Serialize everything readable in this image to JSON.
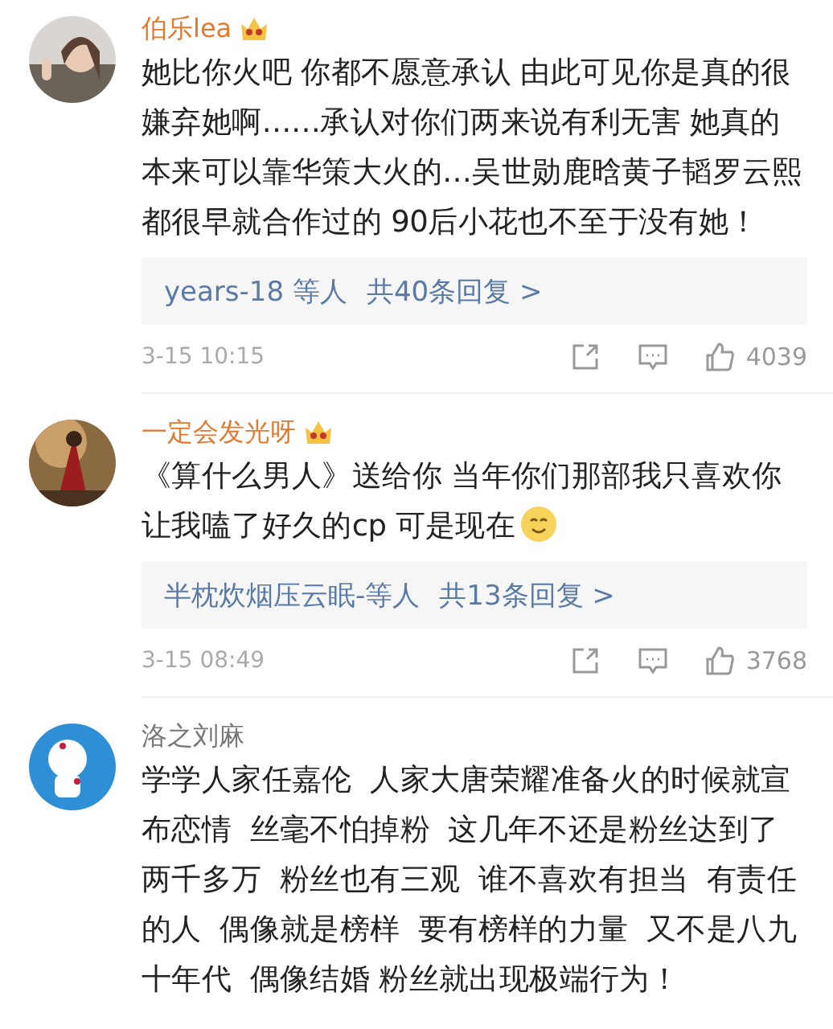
{
  "comments": [
    {
      "name": "伯乐lea",
      "vip": true,
      "text": "她比你火吧 你都不愿意承认 由此可见你是真的很嫌弃她啊……承认对你们两来说有利无害 她真的本来可以靠华策大火的…吴世勋鹿晗黄子韬罗云熙都很早就合作过的 90后小花也不至于没有她！",
      "emoji": false,
      "replies": {
        "users": "years-18 等人",
        "count": "共40条回复 >"
      },
      "time": "3-15 10:15",
      "likes": "4039"
    },
    {
      "name": "一定会发光呀",
      "vip": true,
      "text": "《算什么男人》送给你 当年你们那部我只喜欢你让我嗑了好久的cp 可是现在",
      "emoji": true,
      "replies": {
        "users": "半枕炊烟压云眠-等人",
        "count": "共13条回复 >"
      },
      "time": "3-15 08:49",
      "likes": "3768"
    },
    {
      "name": "洛之刘麻",
      "vip": false,
      "text": "学学人家任嘉伦  人家大唐荣耀准备火的时候就宣布恋情  丝毫不怕掉粉  这几年不还是粉丝达到了两千多万  粉丝也有三观  谁不喜欢有担当  有责任的人  偶像就是榜样  要有榜样的力量  又不是八九十年代  偶像结婚 粉丝就出现极端行为！",
      "emoji": false
    }
  ]
}
